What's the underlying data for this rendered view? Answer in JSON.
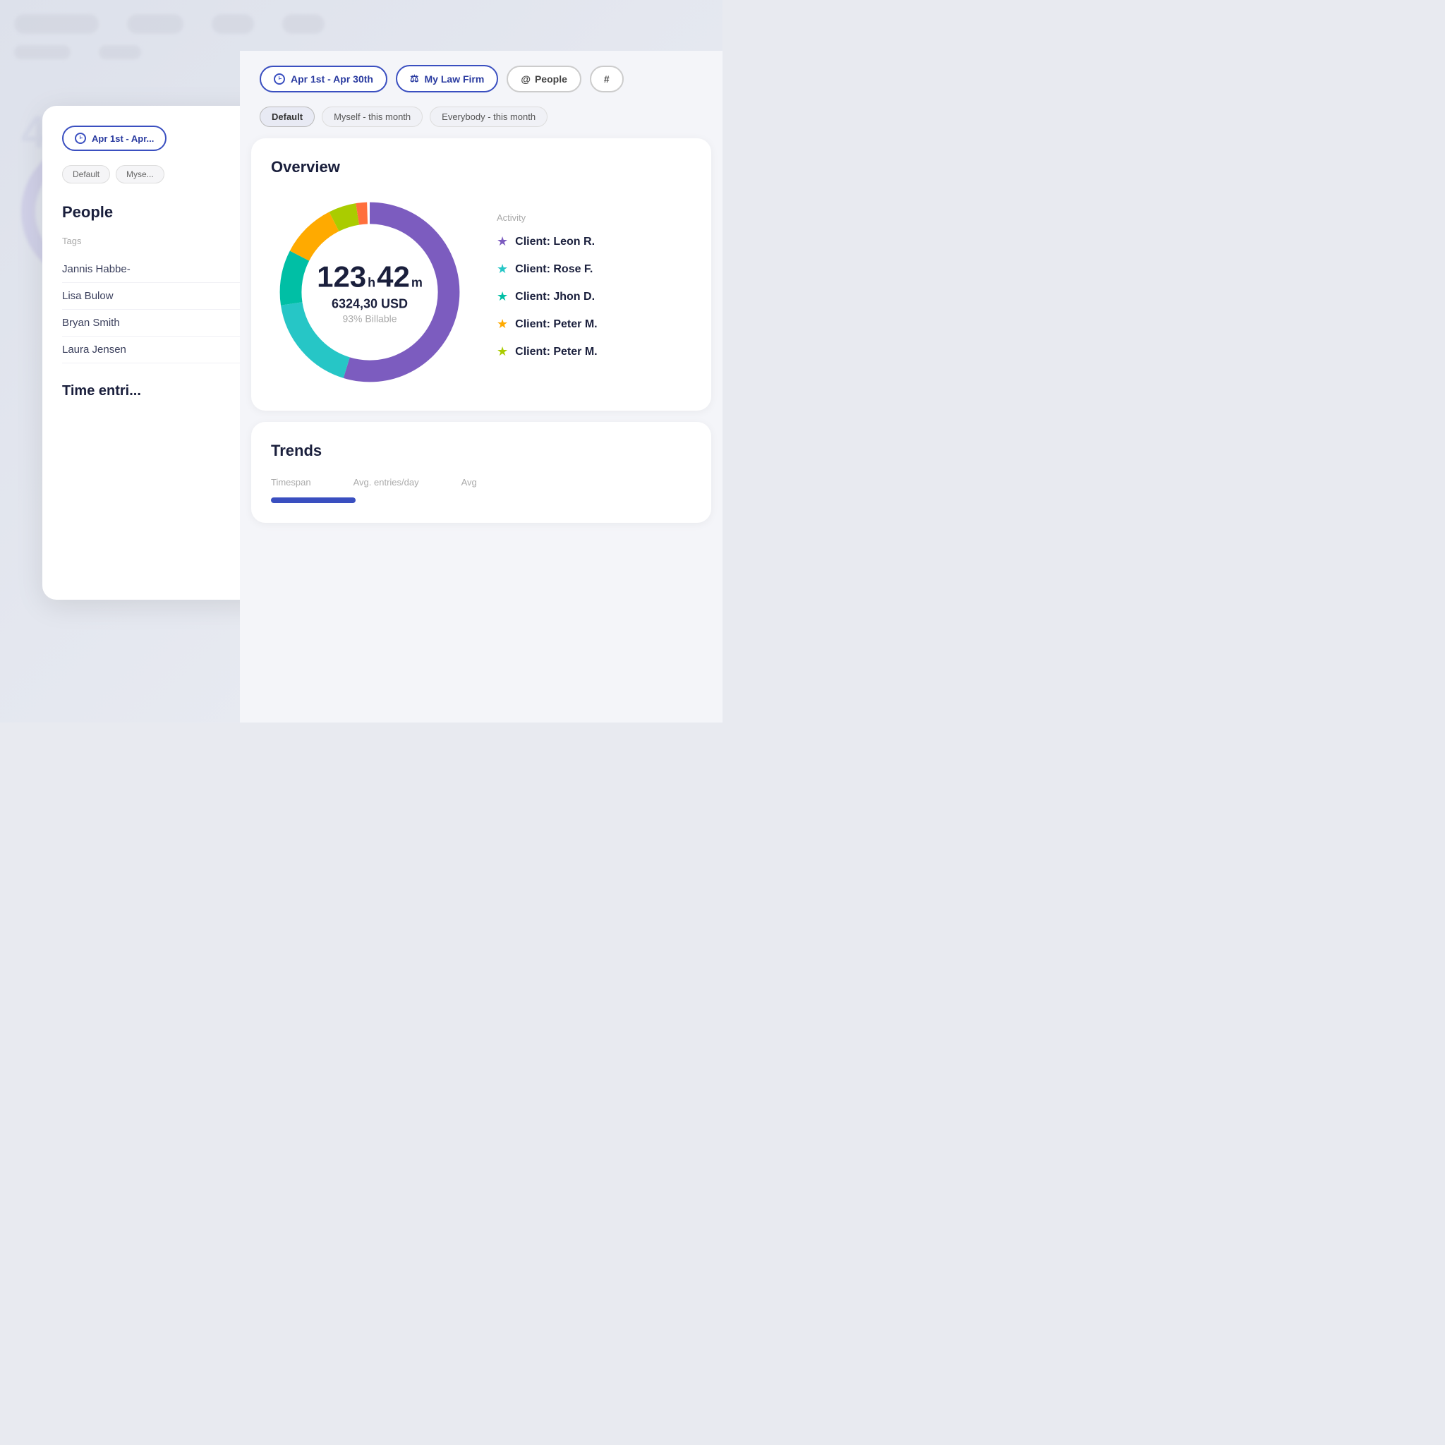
{
  "background": {
    "color": "#e8eaf0"
  },
  "left_panel": {
    "date_btn": "Apr 1st - Apr...",
    "filter_default": "Default",
    "filter_myse": "Myse...",
    "people_title": "People",
    "tags_label": "Tags",
    "people_list": [
      "Jannis Habbe-",
      "Lisa Bulow",
      "Bryan Smith",
      "Laura Jensen"
    ],
    "time_entries_title": "Time entri..."
  },
  "filter_bar": {
    "date_label": "Apr 1st - Apr 30th",
    "firm_label": "My Law Firm",
    "people_label": "People",
    "hash_label": "#"
  },
  "chips": {
    "default": "Default",
    "myself_this_month": "Myself - this month",
    "everybody_this_month": "Everybody - this month"
  },
  "overview": {
    "title": "Overview",
    "hours": "123",
    "minutes": "42",
    "usd": "6324,30 USD",
    "billable": "93% Billable",
    "activity_label": "Activity",
    "activity_items": [
      {
        "client": "Client: Leon R.",
        "color": "#7c5cbf",
        "star": "★"
      },
      {
        "client": "Client: Rose F.",
        "color": "#26c6c6",
        "star": "★"
      },
      {
        "client": "Client: Jhon D.",
        "color": "#00bfa5",
        "star": "★"
      },
      {
        "client": "Client: Peter M.",
        "color": "#ffaa00",
        "star": "★"
      },
      {
        "client": "Client: Peter M.",
        "color": "#aacc00",
        "star": "★"
      }
    ]
  },
  "trends": {
    "title": "Trends",
    "col1": "Timespan",
    "col2": "Avg. entries/day",
    "col3": "Avg"
  },
  "donut": {
    "segments": [
      {
        "color": "#7c5cbf",
        "percent": 55
      },
      {
        "color": "#26c6c6",
        "percent": 18
      },
      {
        "color": "#00bfa5",
        "percent": 10
      },
      {
        "color": "#ffaa00",
        "percent": 10
      },
      {
        "color": "#aacc00",
        "percent": 5
      },
      {
        "color": "#ff6f3c",
        "percent": 2
      }
    ]
  }
}
